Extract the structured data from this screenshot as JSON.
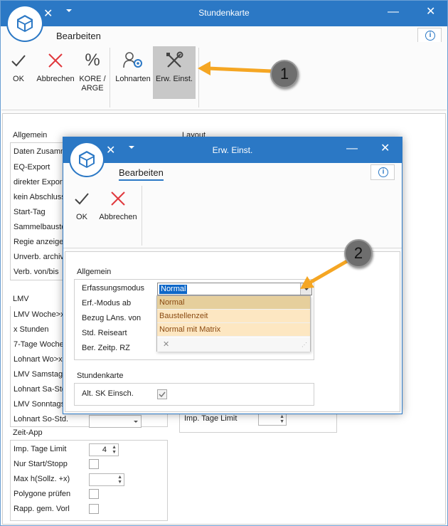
{
  "main": {
    "title": "Stundenkarte",
    "menu_tab": "Bearbeiten",
    "info_label": "i",
    "ribbon": {
      "ok": "OK",
      "abbrechen": "Abbrechen",
      "kore_line1": "KORE /",
      "kore_line2": "ARGE",
      "lohnarten": "Lohnarten",
      "erw": "Erw. Einst."
    },
    "allgemein": {
      "title": "Allgemein",
      "items": [
        "Daten Zusamm",
        "EQ-Export",
        "direkter Export",
        "kein Abschluss",
        "Start-Tag",
        "Sammelbaustel",
        "Regie anzeiger",
        "Unverb. archiv",
        "Verb. von/bis"
      ]
    },
    "layout_title": "Layout",
    "lmv": {
      "title": "LMV",
      "items": [
        "LMV Woche>x",
        "x Stunden",
        "7-Tage Woche",
        "Lohnart Wo>x",
        "LMV Samstags",
        "Lohnart Sa-Std",
        "LMV Sonntags",
        "Lohnart So-Std."
      ]
    },
    "zeitapp": {
      "title": "Zeit-App",
      "imp_tage": "Imp. Tage Limit",
      "imp_value": "4",
      "nur_start": "Nur Start/Stopp",
      "max_h": "Max h(Sollz. +x)",
      "polygone": "Polygone prüfen",
      "rapp": "Rapp. gem. Vorl"
    },
    "right_imp_tage": "Imp. Tage Limit"
  },
  "dialog": {
    "title": "Erw. Einst.",
    "menu_tab": "Bearbeiten",
    "info_label": "i",
    "ok": "OK",
    "abbrechen": "Abbrechen",
    "allgemein_title": "Allgemein",
    "fields": [
      "Erfassungsmodus",
      "Erf.-Modus ab",
      "Bezug LAns. von",
      "Std. Reiseart",
      "Ber. Zeitp. RZ"
    ],
    "combo_value": "Normal",
    "options": [
      "Normal",
      "Baustellenzeit",
      "Normal mit Matrix"
    ],
    "clear_glyph": "✕",
    "stundenkarte_title": "Stundenkarte",
    "alt_sk": "Alt. SK Einsch.",
    "alt_sk_checked": true
  },
  "callouts": [
    "1",
    "2"
  ],
  "colors": {
    "accent": "#2b78c5",
    "cancel_red": "#e0393e",
    "arrow_orange": "#f5a623",
    "highlight": "#e6cf9c"
  }
}
